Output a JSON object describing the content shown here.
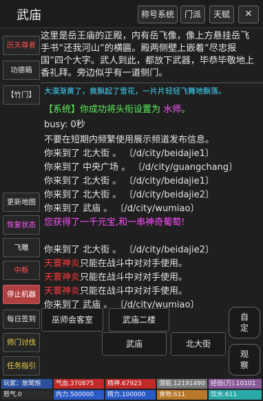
{
  "header": {
    "title": "武庙",
    "buttons": [
      "称号系统",
      "门派",
      "天赋"
    ],
    "close_icon": "✕"
  },
  "room": {
    "description": "这里是岳王庙的正殿，内有岳飞像，像上方悬挂岳飞手书“还我河山”的横匾。殿两侧壁上嵌着“尽忠报国”四个大字。武人到此，都放下武器，毕恭毕敬地上香礼拜。旁边似乎有一道侧门。"
  },
  "left_menu": [
    "历天尊者",
    "功德箱",
    "【竹门】",
    "更新地图",
    "恢复状态",
    "飞雕",
    "中断",
    "停止机器",
    "每日签到",
    "师门讨伐",
    "任务指引"
  ],
  "log": [
    {
      "text": "大漠渐黄了，竟飘起了雪花，一片片轻轻飞舞地飘落。",
      "color": "#3fd9ff"
    },
    {
      "text": "【系统】你成功将头衔设置为 ",
      "color": "#5cf25c",
      "extra": "水师",
      "extra_color": "#ff5cff",
      "suffix": "。"
    },
    {
      "text": "busy: 0秒",
      "color": "#e6e6e6"
    },
    {
      "text": "不要在短期内频繁使用展示频道发布信息。",
      "color": "#e6e6e6"
    },
    {
      "text": "你来到了 北大街 。 〔/d/city/beidajie1〕",
      "color": "#e6e6e6"
    },
    {
      "text": "你来到了 中央广场 。 〔/d/city/guangchang〕",
      "color": "#e6e6e6"
    },
    {
      "text": "你来到了 北大街 。 〔/d/city/beidajie1〕",
      "color": "#e6e6e6"
    },
    {
      "text": "你来到了 北大街 。 〔/d/city/beidajie2〕",
      "color": "#e6e6e6"
    },
    {
      "text": "你来到了 武庙 。 〔/d/city/wumiao〕",
      "color": "#e6e6e6"
    },
    {
      "text": "您获得了一千元宝,和一串神奇葡萄!",
      "color": "#ff4dff"
    },
    {
      "text": "",
      "color": "#e6e6e6"
    },
    {
      "text": "你来到了 北大街 。 〔/d/city/beidajie2〕",
      "color": "#e6e6e6"
    },
    {
      "text": "天寰神炎",
      "color": "#ff3b3b",
      "suffix2": "只能在战斗中对对手使用。"
    },
    {
      "text": "天寰神炎",
      "color": "#ff3b3b",
      "suffix2": "只能在战斗中对对手使用。"
    },
    {
      "text": "天寰神炎",
      "color": "#ff3b3b",
      "suffix2": "只能在战斗中对对手使用。"
    },
    {
      "text": "你来到了 武庙 。 〔/d/city/wumiao〕",
      "color": "#e6e6e6"
    }
  ],
  "actions": {
    "exit1": "巫师会客室",
    "exit2": "武庙二楼",
    "current": "武庙",
    "north": "北大街",
    "custom": "自定",
    "observe": "观察"
  },
  "status": {
    "row1": [
      {
        "label": "玩家：放鹫炮",
        "color": "#2b4f9a",
        "fill": 1.0
      },
      {
        "label": "气血.370875",
        "color": "#c22a2a",
        "fill": 1.0
      },
      {
        "label": "精神.67923",
        "color": "#c22a2a",
        "fill": 1.0
      },
      {
        "label": "潜能.12191490",
        "color": "#7a7a7a",
        "fill": 1.0
      },
      {
        "label": "经验(万).10101",
        "color": "#8b5a9a",
        "fill": 1.0
      }
    ],
    "row2": [
      {
        "label": "怒气.0",
        "color": "#2b2b2b",
        "fill": 1.0
      },
      {
        "label": "内力.500000",
        "color": "#2a5ac8",
        "fill": 1.0
      },
      {
        "label": "精力.100000",
        "color": "#2a5ac8",
        "fill": 1.0
      },
      {
        "label": "食物.611",
        "color": "#b8782a",
        "fill": 1.0
      },
      {
        "label": "饮水.611",
        "color": "#2aa8a8",
        "fill": 1.0
      }
    ]
  }
}
